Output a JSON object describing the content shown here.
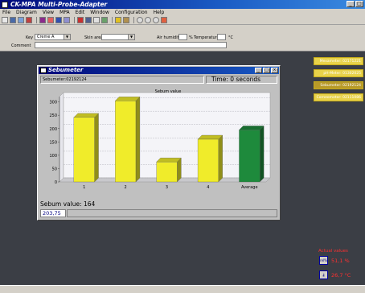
{
  "window": {
    "title": "CK-MPA Multi-Probe-Adapter"
  },
  "menu": [
    "File",
    "Diagram",
    "View",
    "MPA",
    "Edit",
    "Window",
    "Configuration",
    "Help"
  ],
  "fields": {
    "key_label": "Key",
    "key_value": "Creme A",
    "skin_label": "Skin area",
    "skin_value": "",
    "air_humidity_label": "Air humidity",
    "air_humidity_unit": "%",
    "temperature_label": "Temperature",
    "temperature_unit": "°C",
    "comment_label": "Comment"
  },
  "right_panel": [
    "Mexameter: 02171221",
    "pH-Meter: 01302025",
    "Sebumeter: 02192124",
    "Corneometer: 02111086"
  ],
  "sebumeter": {
    "title": "Sebumeter",
    "device": "Sebumeter:02192124",
    "time": "Time: 0 seconds",
    "value_text": "Sebum value: 164",
    "bottom_value": "203,75"
  },
  "chart_data": {
    "type": "bar",
    "title": "Sebum value",
    "categories": [
      "1",
      "2",
      "3",
      "4",
      "Average"
    ],
    "values": [
      242,
      304,
      75,
      160,
      195
    ],
    "colors": [
      "#f0ec2a",
      "#f0ec2a",
      "#f0ec2a",
      "#f0ec2a",
      "#1e8a3c"
    ],
    "yticks": [
      0,
      50,
      100,
      150,
      200,
      250,
      300
    ],
    "ylim": [
      0,
      320
    ],
    "grid": true
  },
  "actual_values": {
    "label": "Actual values",
    "humidity_icon": "rel%",
    "humidity": "51,1 %",
    "temperature": "26,7 °C"
  }
}
